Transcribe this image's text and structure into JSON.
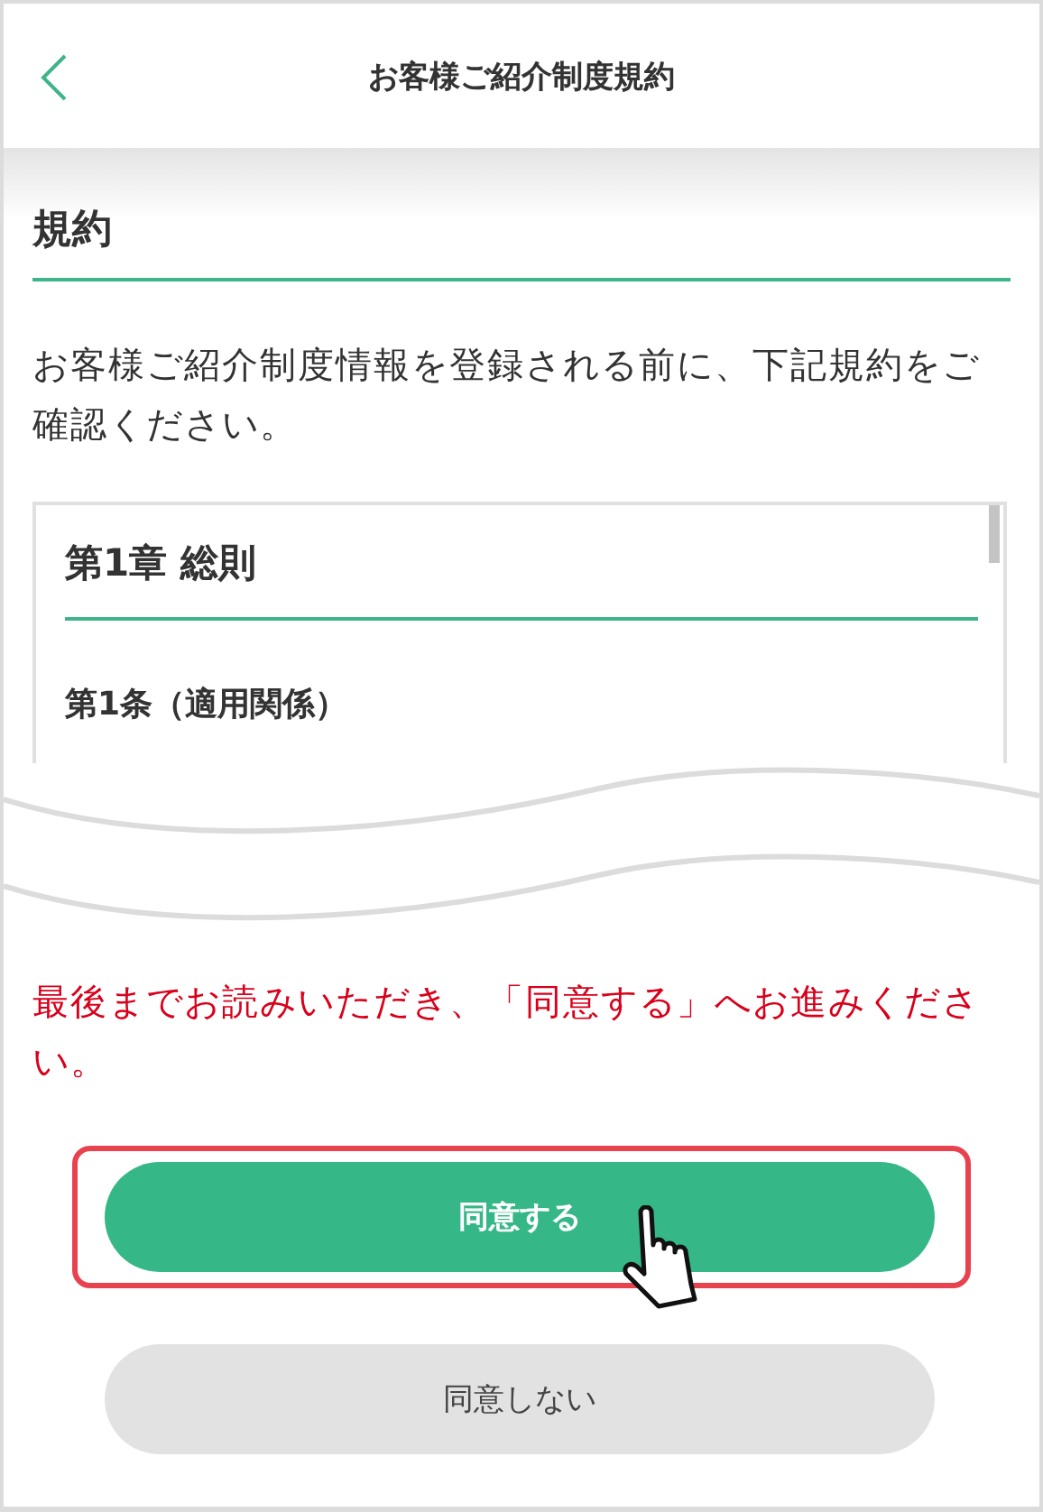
{
  "header": {
    "title": "お客様ご紹介制度規約"
  },
  "section": {
    "heading": "規約"
  },
  "intro": "お客様ご紹介制度情報を登録される前に、下記規約をご確認ください。",
  "terms": {
    "chapter": "第1章 総則",
    "article": "第1条（適用関係）"
  },
  "notice": "最後までお読みいただき、「同意する」へお進みください。",
  "buttons": [
    {
      "label": "同意する",
      "kind": "primary",
      "highlighted": true
    },
    {
      "label": "同意しない",
      "kind": "secondary",
      "highlighted": false
    }
  ]
}
